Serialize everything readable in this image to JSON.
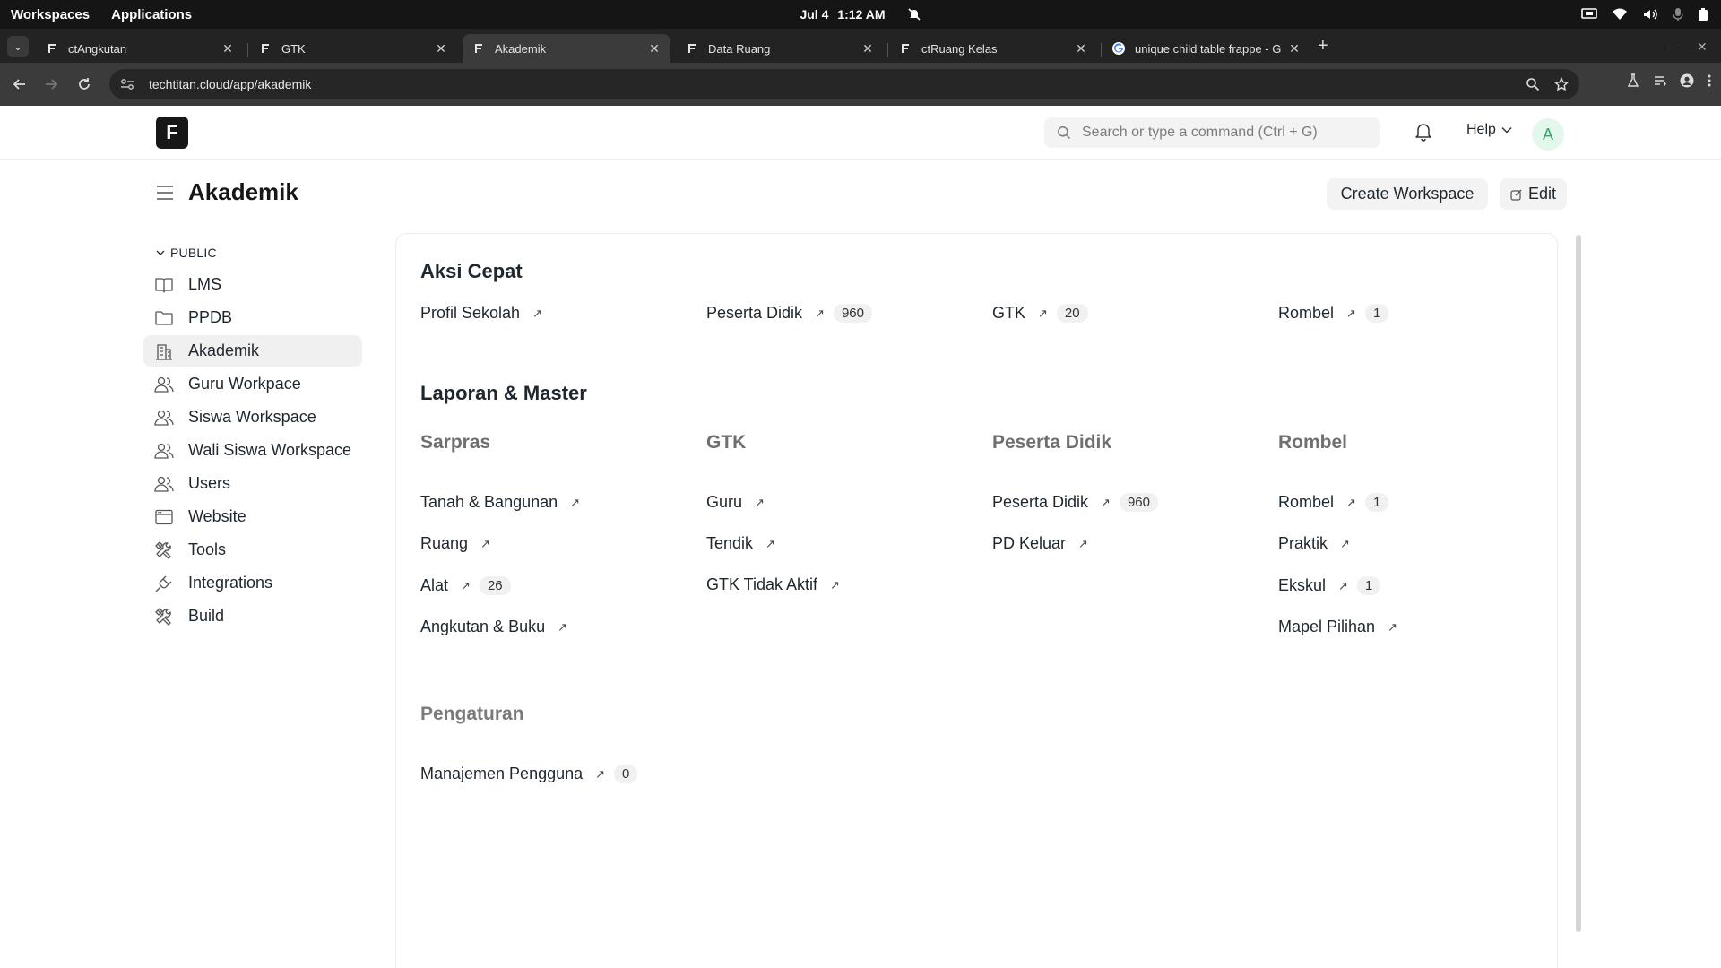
{
  "os": {
    "workspaces_label": "Workspaces",
    "applications_label": "Applications",
    "date": "Jul 4",
    "time": "1:12 AM"
  },
  "browser": {
    "tabs": [
      {
        "title": "ctAngkutan",
        "favicon": "frappe-icon",
        "active": false
      },
      {
        "title": "GTK",
        "favicon": "frappe-icon",
        "active": false
      },
      {
        "title": "Akademik",
        "favicon": "frappe-icon",
        "active": true
      },
      {
        "title": "Data Ruang",
        "favicon": "frappe-icon",
        "active": false
      },
      {
        "title": "ctRuang Kelas",
        "favicon": "frappe-icon",
        "active": false
      },
      {
        "title": "unique child table frappe - G",
        "favicon": "google-icon",
        "active": false
      }
    ],
    "url": "techtitan.cloud/app/akademik"
  },
  "app": {
    "logo_letter": "F",
    "search_placeholder": "Search or type a command (Ctrl + G)",
    "help_label": "Help",
    "avatar_letter": "A"
  },
  "page": {
    "title": "Akademik",
    "create_workspace_label": "Create Workspace",
    "edit_label": "Edit"
  },
  "sidebar": {
    "section_label": "PUBLIC",
    "items": [
      {
        "label": "LMS",
        "icon": "book-icon"
      },
      {
        "label": "PPDB",
        "icon": "folder-icon"
      },
      {
        "label": "Akademik",
        "icon": "building-icon"
      },
      {
        "label": "Guru Workpace",
        "icon": "users-icon"
      },
      {
        "label": "Siswa Workspace",
        "icon": "users-icon"
      },
      {
        "label": "Wali Siswa Workspace",
        "icon": "users-icon"
      },
      {
        "label": "Users",
        "icon": "users-icon"
      },
      {
        "label": "Website",
        "icon": "browser-icon"
      },
      {
        "label": "Tools",
        "icon": "tools-icon"
      },
      {
        "label": "Integrations",
        "icon": "plug-icon"
      },
      {
        "label": "Build",
        "icon": "tools-icon"
      }
    ]
  },
  "quick_actions": {
    "title": "Aksi Cepat",
    "items": [
      {
        "label": "Profil Sekolah",
        "count": ""
      },
      {
        "label": "Peserta Didik",
        "count": "960"
      },
      {
        "label": "GTK",
        "count": "20"
      },
      {
        "label": "Rombel",
        "count": "1"
      }
    ]
  },
  "reports": {
    "title": "Laporan & Master",
    "groups": [
      {
        "title": "Sarpras",
        "links": [
          {
            "label": "Tanah & Bangunan",
            "count": ""
          },
          {
            "label": "Ruang",
            "count": ""
          },
          {
            "label": "Alat",
            "count": "26"
          },
          {
            "label": "Angkutan & Buku",
            "count": ""
          }
        ]
      },
      {
        "title": "GTK",
        "links": [
          {
            "label": "Guru",
            "count": ""
          },
          {
            "label": "Tendik",
            "count": ""
          },
          {
            "label": "GTK Tidak Aktif",
            "count": ""
          }
        ]
      },
      {
        "title": "Peserta Didik",
        "links": [
          {
            "label": "Peserta Didik",
            "count": "960"
          },
          {
            "label": "PD Keluar",
            "count": ""
          }
        ]
      },
      {
        "title": "Rombel",
        "links": [
          {
            "label": "Rombel",
            "count": "1"
          },
          {
            "label": "Praktik",
            "count": ""
          },
          {
            "label": "Ekskul",
            "count": "1"
          },
          {
            "label": "Mapel Pilihan",
            "count": ""
          }
        ]
      }
    ]
  },
  "settings": {
    "title": "Pengaturan",
    "links": [
      {
        "label": "Manajemen Pengguna",
        "count": "0"
      }
    ]
  }
}
